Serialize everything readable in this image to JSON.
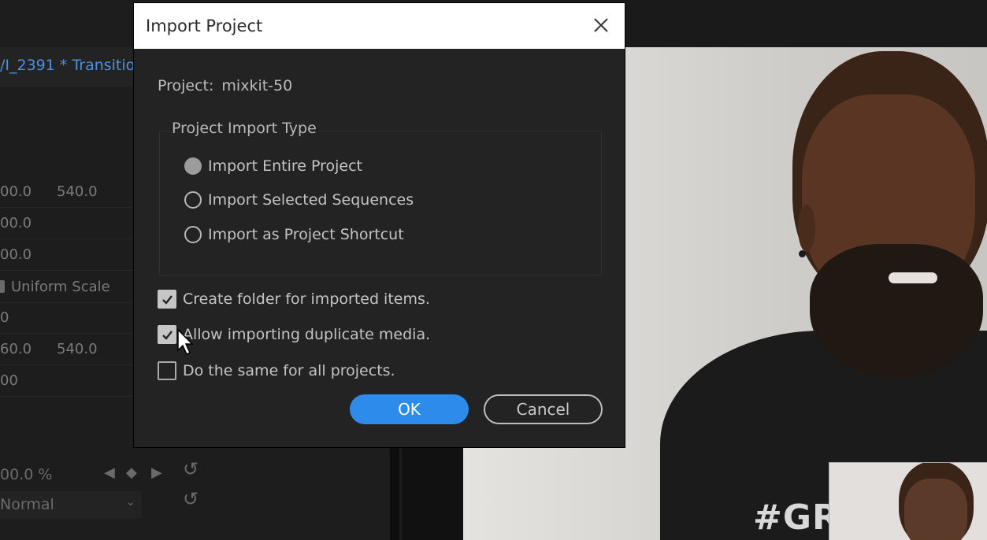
{
  "background_app": {
    "sequence_tab": "/I_2391 * Transitio",
    "effect_rows": [
      {
        "v1": "00.0",
        "v2": "540.0"
      },
      {
        "v1": "00.0",
        "v2": ""
      },
      {
        "v1": "00.0",
        "v2": ""
      },
      {
        "checkbox_label": "Uniform Scale"
      },
      {
        "v1": "0",
        "v2": ""
      },
      {
        "v1": "60.0",
        "v2": "540.0"
      },
      {
        "v1": "00",
        "v2": ""
      }
    ],
    "opacity_value": "00.0 %",
    "blend_mode": "Normal"
  },
  "video": {
    "shirt_text": "#GRO"
  },
  "dialog": {
    "title": "Import Project",
    "project_label": "Project:",
    "project_name": "mixkit-50",
    "import_type_legend": "Project Import Type",
    "options": [
      {
        "label": "Import Entire Project",
        "selected": true
      },
      {
        "label": "Import Selected Sequences",
        "selected": false
      },
      {
        "label": "Import as Project Shortcut",
        "selected": false
      }
    ],
    "checkboxes": [
      {
        "label": "Create folder for imported items.",
        "checked": true
      },
      {
        "label": "Allow importing duplicate media.",
        "checked": true
      },
      {
        "label": "Do the same for all projects.",
        "checked": false
      }
    ],
    "ok_label": "OK",
    "cancel_label": "Cancel",
    "colors": {
      "accent": "#2d8ceb",
      "background": "#232323",
      "titlebar": "#ffffff"
    }
  }
}
